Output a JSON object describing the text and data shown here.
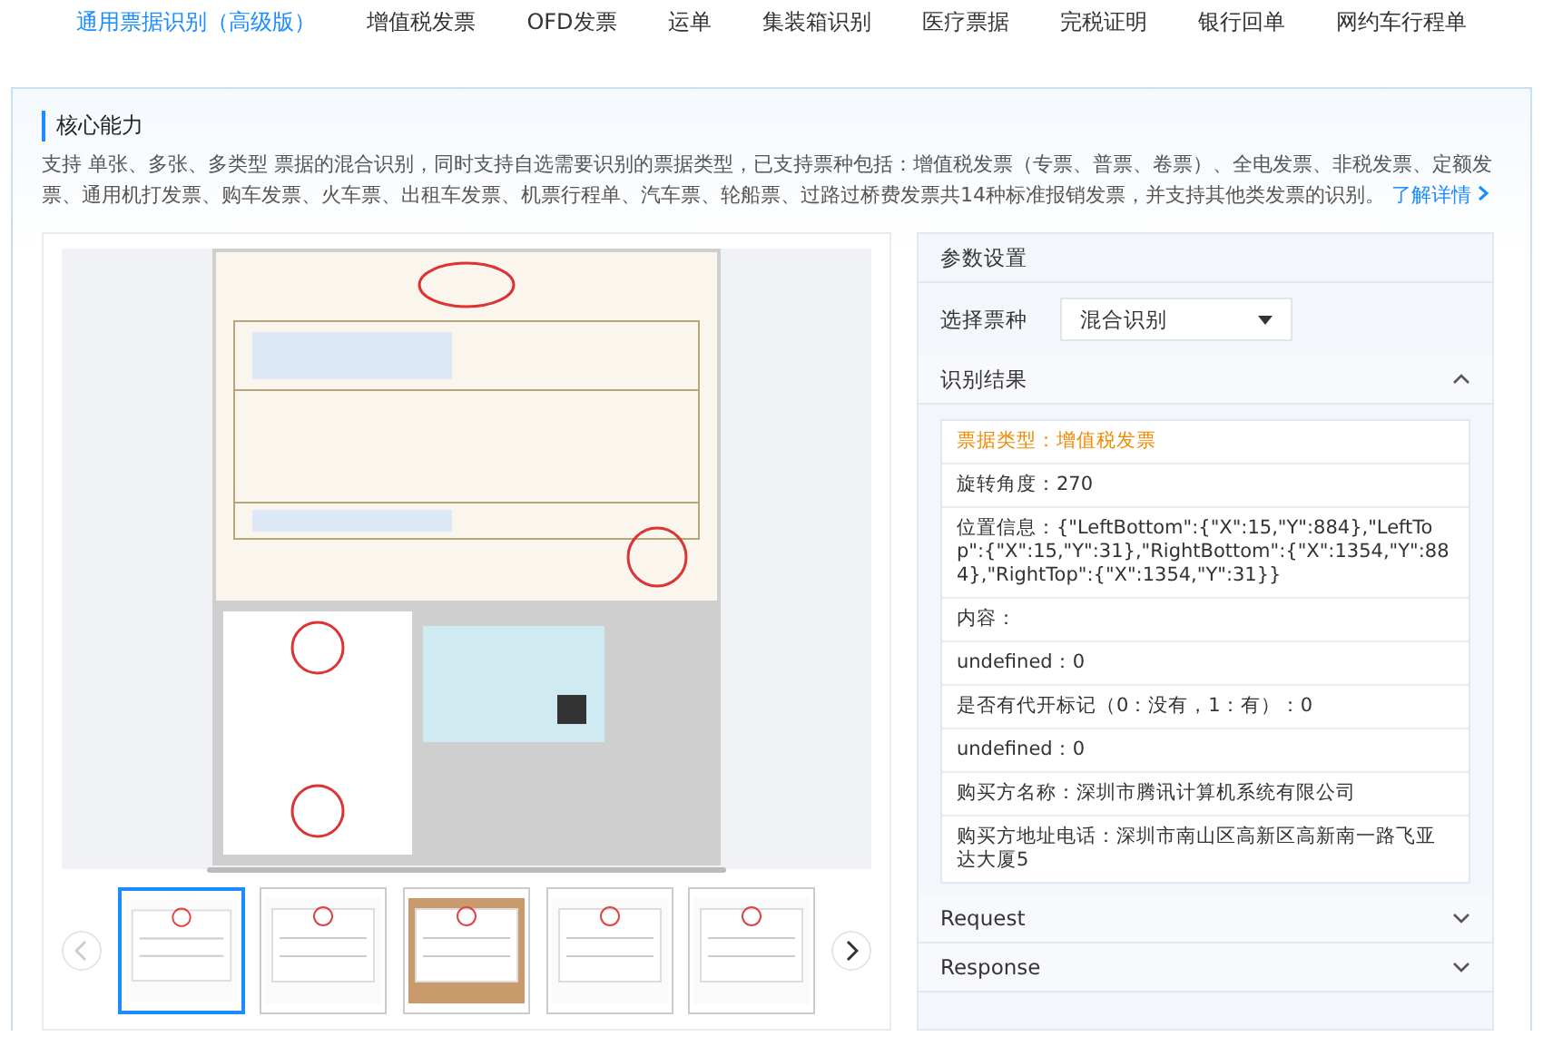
{
  "nav": {
    "tabs": [
      {
        "label": "通用票据识别（高级版）",
        "selected": true
      },
      {
        "label": "增值税发票",
        "selected": false
      },
      {
        "label": "OFD发票",
        "selected": false
      },
      {
        "label": "运单",
        "selected": false
      },
      {
        "label": "集装箱识别",
        "selected": false
      },
      {
        "label": "医疗票据",
        "selected": false
      },
      {
        "label": "完税证明",
        "selected": false
      },
      {
        "label": "银行回单",
        "selected": false
      },
      {
        "label": "网约车行程单",
        "selected": false
      }
    ]
  },
  "core": {
    "title": "核心能力",
    "description": "支持 单张、多张、多类型 票据的混合识别，同时支持自选需要识别的票据类型，已支持票种包括：增值税发票（专票、普票、卷票）、全电发票、非税发票、定额发票、通用机打发票、购车发票、火车票、出租车发票、机票行程单、汽车票、轮船票、过路过桥费发票共14种标准报销发票，并支持其他类发票的识别。",
    "link": "了解详情"
  },
  "demo": {
    "thumbnails": [
      {
        "selected": true
      },
      {
        "selected": false
      },
      {
        "selected": false
      },
      {
        "selected": false
      },
      {
        "selected": false
      }
    ]
  },
  "settings": {
    "title": "参数设置",
    "select_label": "选择票种",
    "select_value": "混合识别"
  },
  "results": {
    "title": "识别结果",
    "expanded": true,
    "rows": [
      {
        "kind": "type",
        "text": "票据类型：增值税发票"
      },
      {
        "kind": "field",
        "text": "旋转角度：270"
      },
      {
        "kind": "field",
        "text": "位置信息：{\"LeftBottom\":{\"X\":15,\"Y\":884},\"LeftTop\":{\"X\":15,\"Y\":31},\"RightBottom\":{\"X\":1354,\"Y\":884},\"RightTop\":{\"X\":1354,\"Y\":31}}"
      },
      {
        "kind": "field",
        "text": "内容："
      },
      {
        "kind": "field",
        "text": "undefined：0"
      },
      {
        "kind": "field",
        "text": "是否有代开标记（0：没有，1：有）：0"
      },
      {
        "kind": "field",
        "text": "undefined：0"
      },
      {
        "kind": "field",
        "text": "购买方名称：深圳市腾讯计算机系统有限公司"
      },
      {
        "kind": "field",
        "text": "购买方地址电话：深圳市南山区高新区高新南一路飞亚达大厦5"
      }
    ]
  },
  "sections": [
    {
      "label": "Request",
      "expanded": false
    },
    {
      "label": "Response",
      "expanded": false
    }
  ]
}
